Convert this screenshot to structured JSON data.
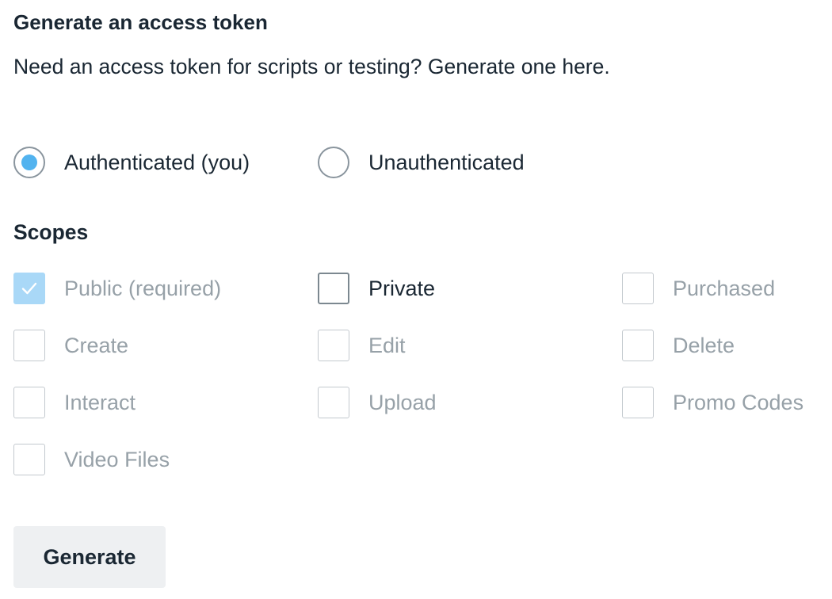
{
  "section": {
    "title": "Generate an access token",
    "description": "Need an access token for scripts or testing? Generate one here."
  },
  "auth_options": [
    {
      "label": "Authenticated (you)",
      "selected": true
    },
    {
      "label": "Unauthenticated",
      "selected": false
    }
  ],
  "scopes": {
    "heading": "Scopes",
    "items": [
      {
        "label": "Public (required)",
        "checked": true,
        "disabled": true
      },
      {
        "label": "Private",
        "checked": false,
        "disabled": false
      },
      {
        "label": "Purchased",
        "checked": false,
        "disabled": true
      },
      {
        "label": "Create",
        "checked": false,
        "disabled": true
      },
      {
        "label": "Edit",
        "checked": false,
        "disabled": true
      },
      {
        "label": "Delete",
        "checked": false,
        "disabled": true
      },
      {
        "label": "Interact",
        "checked": false,
        "disabled": true
      },
      {
        "label": "Upload",
        "checked": false,
        "disabled": true
      },
      {
        "label": "Promo Codes",
        "checked": false,
        "disabled": true
      },
      {
        "label": "Video Files",
        "checked": false,
        "disabled": true
      }
    ]
  },
  "generate_button": {
    "label": "Generate"
  },
  "colors": {
    "text_primary": "#1a2733",
    "text_disabled": "#97a1a8",
    "radio_selected": "#52b3ef",
    "checkbox_checked_disabled": "#a9d8f7",
    "button_background": "#eef0f2"
  },
  "icons": {
    "check": "check-icon"
  }
}
